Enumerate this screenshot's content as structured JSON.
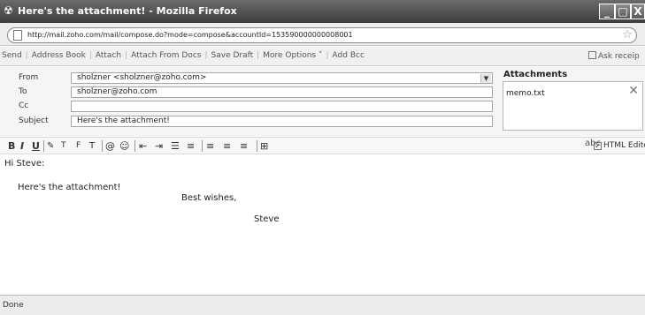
{
  "window": {
    "title": "Here's the attachment! - Mozilla Firefox",
    "buttons": {
      "minimize": "_",
      "maximize": "□",
      "close": "X"
    }
  },
  "browser": {
    "url": "http://mail.zoho.com/mail/compose.do?mode=compose&accountId=153590000000008001",
    "status": "Done"
  },
  "toolbar": {
    "send": "Send",
    "address_book": "Address Book",
    "attach": "Attach",
    "attach_from_docs": "Attach From Docs",
    "save_draft": "Save Draft",
    "more_options": "More Options ˅",
    "add_bcc": "Add Bcc",
    "ask_receipt": "Ask receip"
  },
  "compose": {
    "from_label": "From",
    "from_value": "sholzner <sholzner@zoho.com>",
    "to_label": "To",
    "to_value": "sholzner@zoho.com",
    "cc_label": "Cc",
    "cc_value": "",
    "subject_label": "Subject",
    "subject_value": "Here's the attachment!"
  },
  "attachments": {
    "title": "Attachments",
    "files": [
      {
        "name": "memo.txt"
      }
    ]
  },
  "format": {
    "html_editor": "HTML Editor",
    "html_editor_checked": true
  },
  "body": {
    "greeting": "Hi Steve:",
    "line1": "Here's the attachment!",
    "closing": "Best wishes,",
    "signature": "Steve"
  }
}
